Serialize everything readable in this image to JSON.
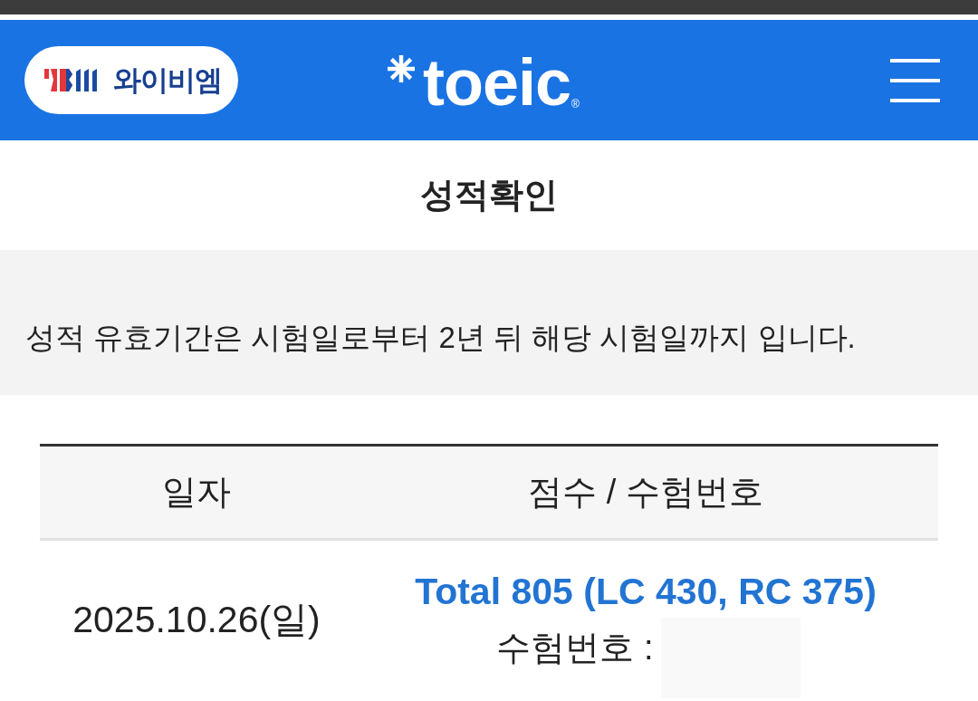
{
  "header": {
    "logo": {
      "text": "와이비엠"
    },
    "brand": {
      "name": "toeic",
      "mark": "®"
    }
  },
  "page_title": "성적확인",
  "notice": "성적 유효기간은 시험일로부터 2년 뒤 해당 시험일까지 입니다.",
  "table": {
    "columns": [
      "일자",
      "점수 / 수험번호"
    ],
    "rows": [
      {
        "date": "2025.10.26(일)",
        "score": "Total 805 (LC 430, RC 375)",
        "exam_number": {
          "label": "수험번호 :",
          "redacted": true
        }
      }
    ]
  }
}
